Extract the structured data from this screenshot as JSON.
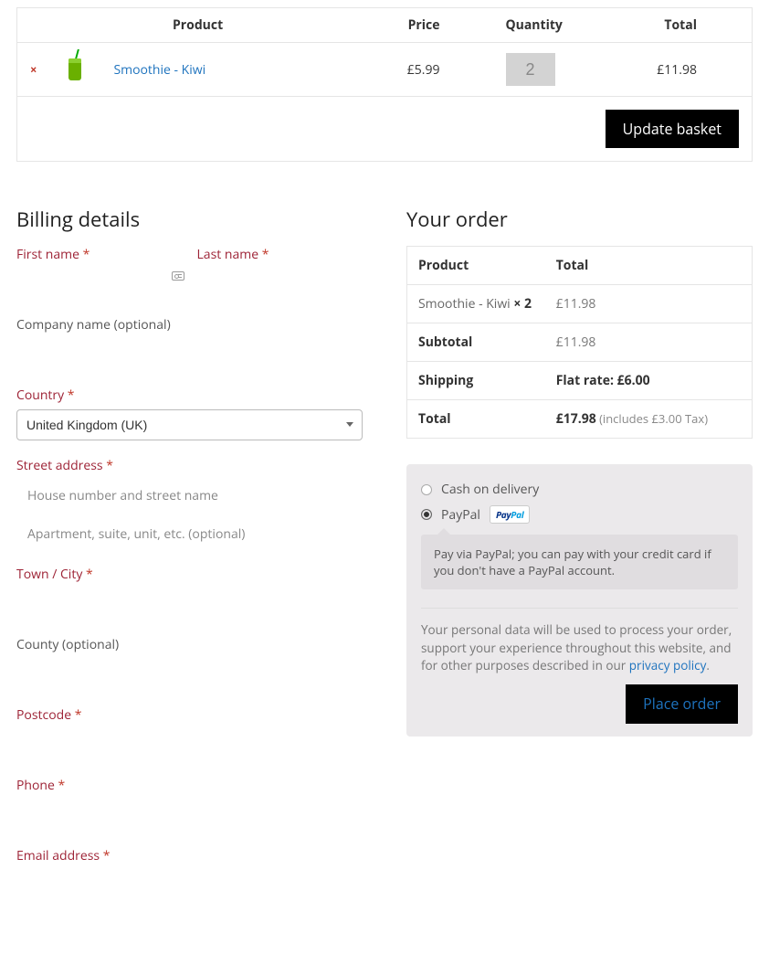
{
  "basket": {
    "headers": {
      "product": "Product",
      "price": "Price",
      "qty": "Quantity",
      "total": "Total"
    },
    "item": {
      "name": "Smoothie - Kiwi",
      "price": "£5.99",
      "qty": "2",
      "total": "£11.98",
      "remove_icon": "×"
    },
    "update_label": "Update basket"
  },
  "billing": {
    "heading": "Billing details",
    "first_name": "First name",
    "last_name": "Last name",
    "company": "Company name (optional)",
    "country": "Country",
    "country_value": "United Kingdom (UK)",
    "street": "Street address",
    "street_placeholder": "House number and street name",
    "street2_placeholder": "Apartment, suite, unit, etc. (optional)",
    "city": "Town / City",
    "county": "County (optional)",
    "postcode": "Postcode",
    "phone": "Phone",
    "email": "Email address",
    "req": "*"
  },
  "order": {
    "heading": "Your order",
    "product_col": "Product",
    "total_col": "Total",
    "item_name": "Smoothie - Kiwi ",
    "item_qty_prefix": " × 2",
    "item_total": "£11.98",
    "subtotal_label": "Subtotal",
    "subtotal_value": "£11.98",
    "shipping_label": "Shipping",
    "shipping_value": "Flat rate: £6.00",
    "total_label": "Total",
    "total_value": "£17.98",
    "tax_note": " (includes £3.00 Tax)"
  },
  "payment": {
    "cod": "Cash on delivery",
    "paypal": "PayPal",
    "paypal_badge_a": "Pay",
    "paypal_badge_b": "Pal",
    "paypal_desc": "Pay via PayPal; you can pay with your credit card if you don't have a PayPal account.",
    "privacy_text_a": "Your personal data will be used to process your order, support your experience throughout this website, and for other purposes described in our ",
    "privacy_link": "privacy policy",
    "privacy_text_b": ".",
    "place_label": "Place order"
  }
}
